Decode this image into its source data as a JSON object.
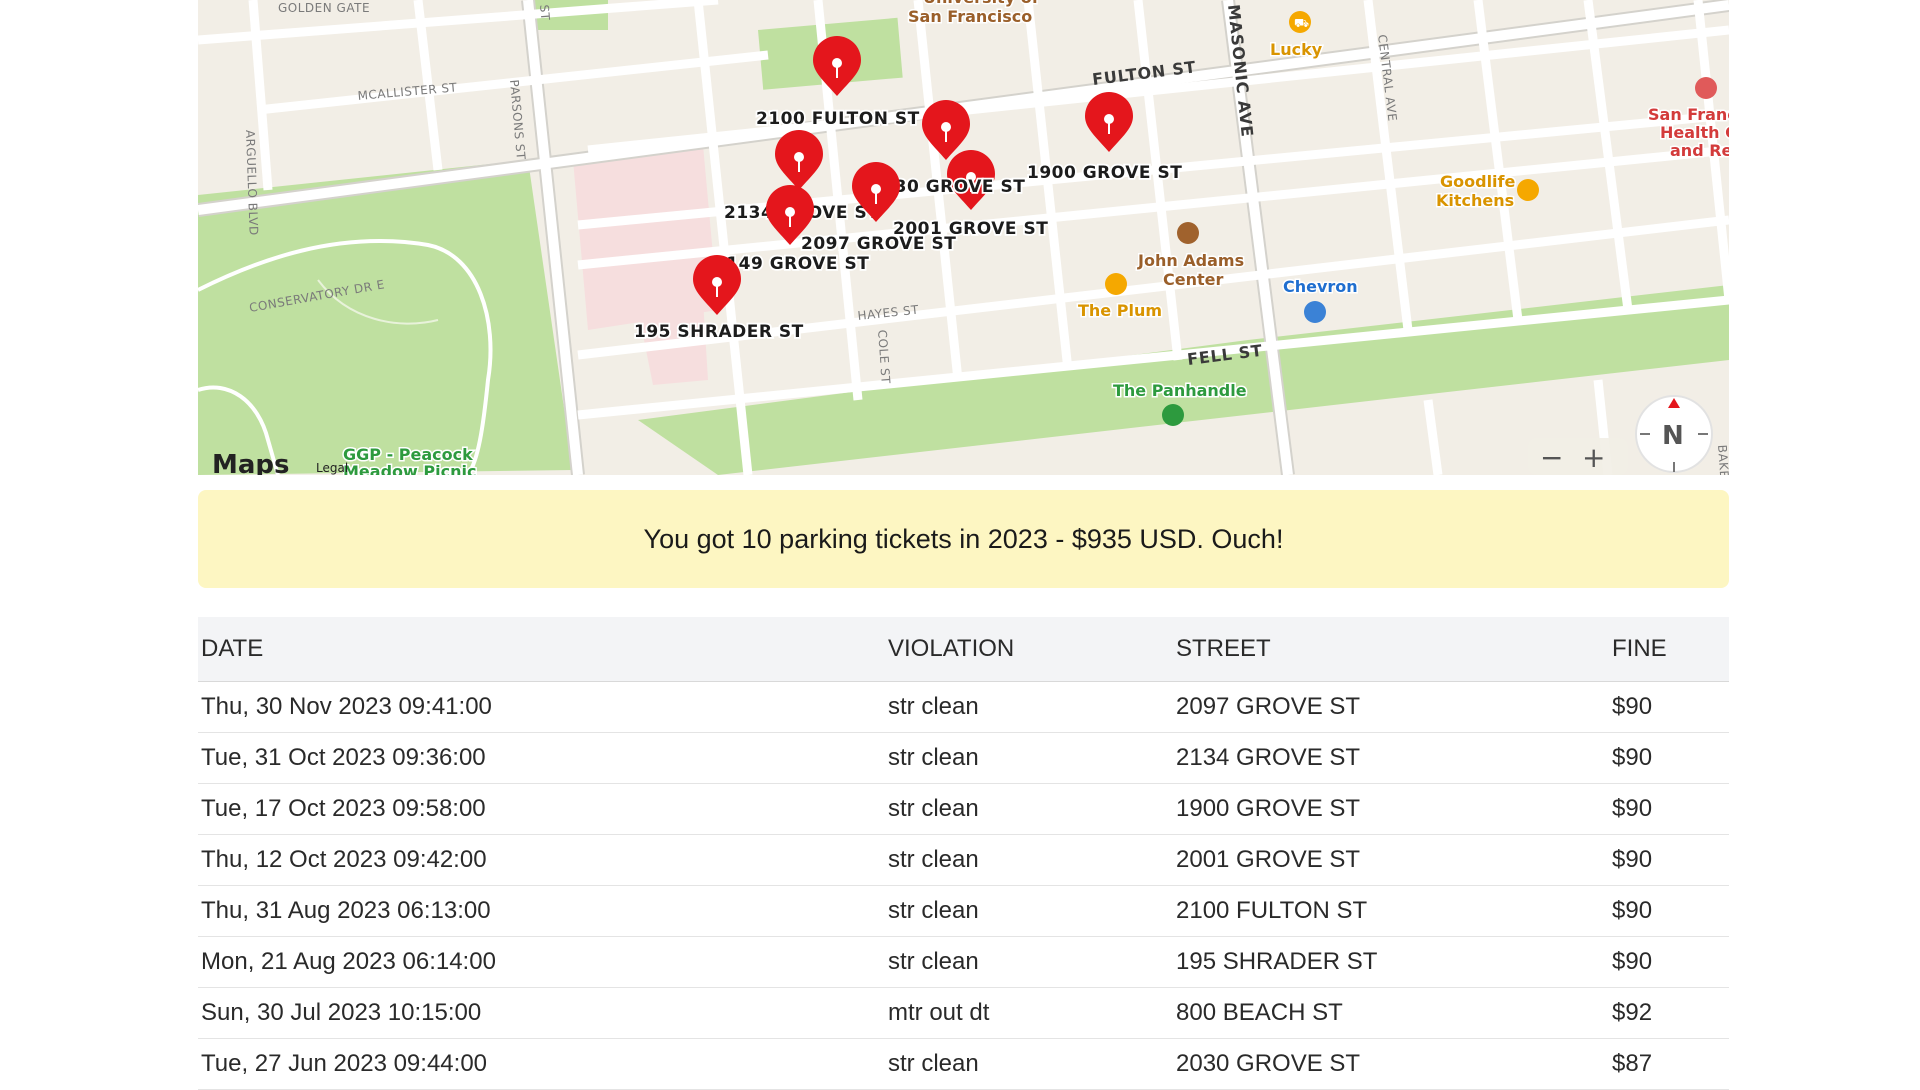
{
  "map": {
    "pins": [
      {
        "label": "2100 FULTON ST"
      },
      {
        "label": "2030 GROVE ST"
      },
      {
        "label": "1900 GROVE ST"
      },
      {
        "label": "2134 GROVE ST"
      },
      {
        "label": "2001 GROVE ST"
      },
      {
        "label": "2097 GROVE ST"
      },
      {
        "label": "2149 GROVE ST"
      },
      {
        "label": "195 SHRADER ST"
      }
    ],
    "streets": {
      "golden_gate": "GOLDEN GATE",
      "arguello": "ARGUELLO BLVD",
      "mcallister": "MCALLISTER ST",
      "parsons": "PARSONS ST",
      "st": "ST",
      "fulton": "FULTON ST",
      "masonic": "MASONIC AVE",
      "central": "CENTRAL AVE",
      "conservatory": "CONSERVATORY DR E",
      "hayes": "HAYES ST",
      "cole": "COLE ST",
      "fell": "FELL ST",
      "baker": "BAKER"
    },
    "pois": {
      "usf": "University of San Francisco",
      "lucky": "Lucky",
      "sf_health": "San Francisco Health Care and Rehab",
      "goodlife": "Goodlife Kitchens",
      "john_adams": "John Adams Center",
      "chevron": "Chevron",
      "the_plum": "The Plum",
      "panhandle": "The Panhandle",
      "ggp": "GGP - Peacock Meadow Picnic"
    },
    "brand": "Maps",
    "legal": "Legal",
    "compass_label": "N",
    "zoom_out_label": "−",
    "zoom_in_label": "+"
  },
  "banner": {
    "text": "You got 10 parking tickets in 2023 - $935 USD. Ouch!"
  },
  "table": {
    "headers": {
      "date": "DATE",
      "violation": "VIOLATION",
      "street": "STREET",
      "fine": "FINE"
    },
    "rows": [
      {
        "date": "Thu, 30 Nov 2023 09:41:00",
        "violation": "str clean",
        "street": "2097 GROVE ST",
        "fine": "$90"
      },
      {
        "date": "Tue, 31 Oct 2023 09:36:00",
        "violation": "str clean",
        "street": "2134 GROVE ST",
        "fine": "$90"
      },
      {
        "date": "Tue, 17 Oct 2023 09:58:00",
        "violation": "str clean",
        "street": "1900 GROVE ST",
        "fine": "$90"
      },
      {
        "date": "Thu, 12 Oct 2023 09:42:00",
        "violation": "str clean",
        "street": "2001 GROVE ST",
        "fine": "$90"
      },
      {
        "date": "Thu, 31 Aug 2023 06:13:00",
        "violation": "str clean",
        "street": "2100 FULTON ST",
        "fine": "$90"
      },
      {
        "date": "Mon, 21 Aug 2023 06:14:00",
        "violation": "str clean",
        "street": "195 SHRADER ST",
        "fine": "$90"
      },
      {
        "date": "Sun, 30 Jul 2023 10:15:00",
        "violation": "mtr out dt",
        "street": "800 BEACH ST",
        "fine": "$92"
      },
      {
        "date": "Tue, 27 Jun 2023 09:44:00",
        "violation": "str clean",
        "street": "2030 GROVE ST",
        "fine": "$87"
      }
    ]
  },
  "colors": {
    "pin": "#e4161c",
    "banner_bg": "#fdf6c2",
    "park_green": "#bfe0a0",
    "road": "#ffffff"
  }
}
